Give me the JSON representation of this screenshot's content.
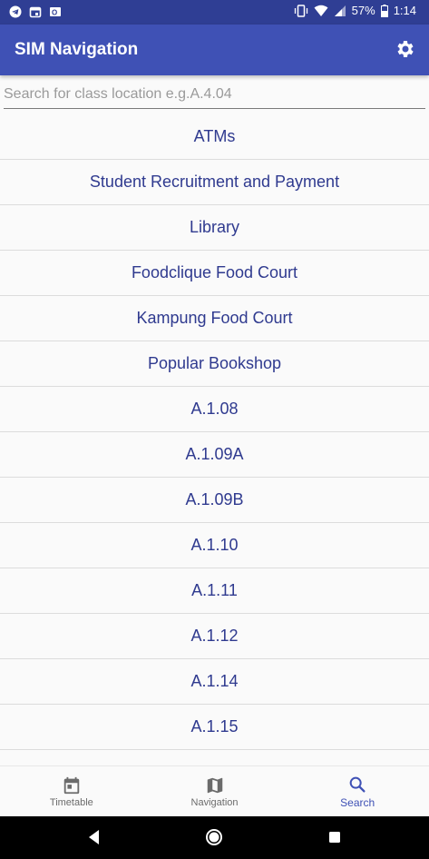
{
  "status_bar": {
    "left_icons": [
      "telegram-icon",
      "calendar-icon",
      "outlook-icon"
    ],
    "right_icons": [
      "vibrate-icon",
      "wifi-icon",
      "signal-icon"
    ],
    "battery": "57%",
    "time": "1:14"
  },
  "app_bar": {
    "title": "SIM Navigation",
    "settings_icon": "gear-icon"
  },
  "search": {
    "placeholder": "Search for class location e.g.A.4.04",
    "value": ""
  },
  "list": {
    "items": [
      "ATMs",
      "Student Recruitment and Payment",
      "Library",
      "Foodclique Food Court",
      "Kampung Food Court",
      "Popular Bookshop",
      "A.1.08",
      "A.1.09A",
      "A.1.09B",
      "A.1.10",
      "A.1.11",
      "A.1.12",
      "A.1.14",
      "A.1.15"
    ]
  },
  "bottom_nav": {
    "items": [
      {
        "label": "Timetable",
        "icon": "calendar-icon",
        "active": false
      },
      {
        "label": "Navigation",
        "icon": "map-icon",
        "active": false
      },
      {
        "label": "Search",
        "icon": "search-icon",
        "active": true
      }
    ]
  },
  "colors": {
    "primary": "#3f51b5",
    "primary_dark": "#2f3e94",
    "list_text": "#2f3a8f"
  }
}
